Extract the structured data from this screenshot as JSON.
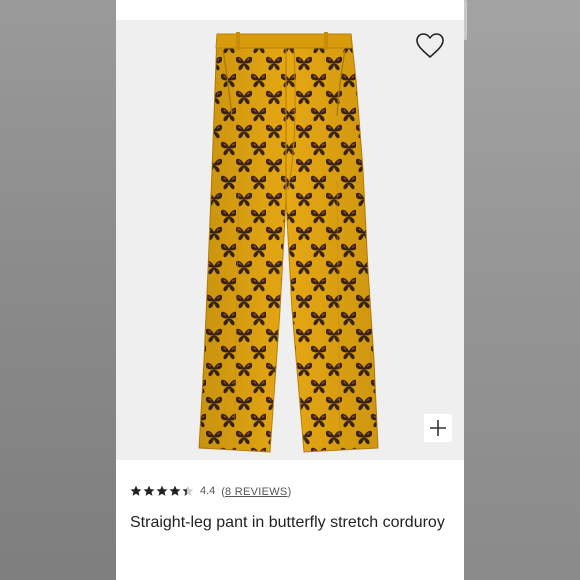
{
  "product": {
    "rating_value": "4.4",
    "reviews_open": "(",
    "reviews_label": "8 REVIEWS",
    "reviews_close": ")",
    "rating": 4.4,
    "rating_max": 5,
    "title": "Straight-leg pant in butterfly stretch corduroy"
  },
  "icons": {
    "favorite": "heart-outline-icon",
    "zoom": "plus-icon",
    "star": "star-icon"
  },
  "colors": {
    "fabric": "#e5a712",
    "butterfly": "#3b2418",
    "star": "#222222"
  }
}
